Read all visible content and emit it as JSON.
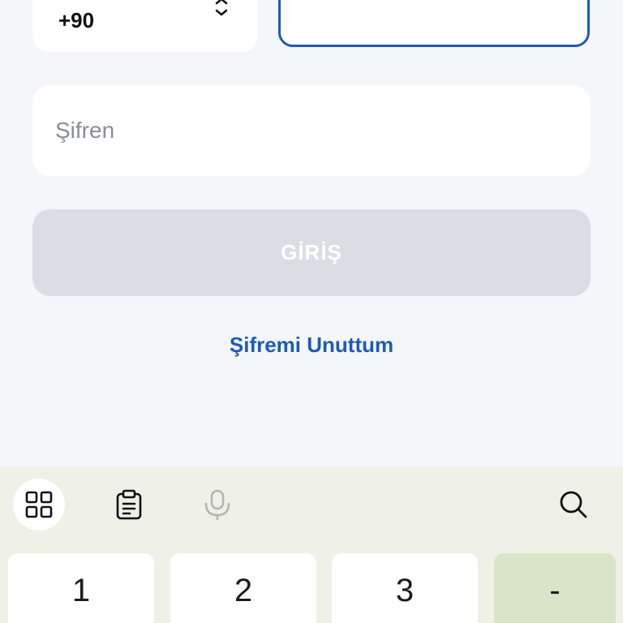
{
  "login_form": {
    "country_code": "+90",
    "phone_value": "",
    "password_placeholder": "Şifren",
    "login_button_label": "GİRİŞ",
    "forgot_password_label": "Şifremi Unuttum"
  },
  "keyboard": {
    "toolbar": [
      {
        "icon": "apps-grid-icon"
      },
      {
        "icon": "clipboard-icon"
      },
      {
        "icon": "microphone-icon"
      },
      {
        "icon": "search-icon"
      }
    ],
    "keys": [
      "1",
      "2",
      "3",
      "-"
    ]
  },
  "colors": {
    "accent": "#1f5bb5",
    "background": "#f5f6fa",
    "button_disabled": "#dcdde4",
    "keyboard_bg": "#eff0e6",
    "symbol_key_bg": "#d9e5c8"
  }
}
